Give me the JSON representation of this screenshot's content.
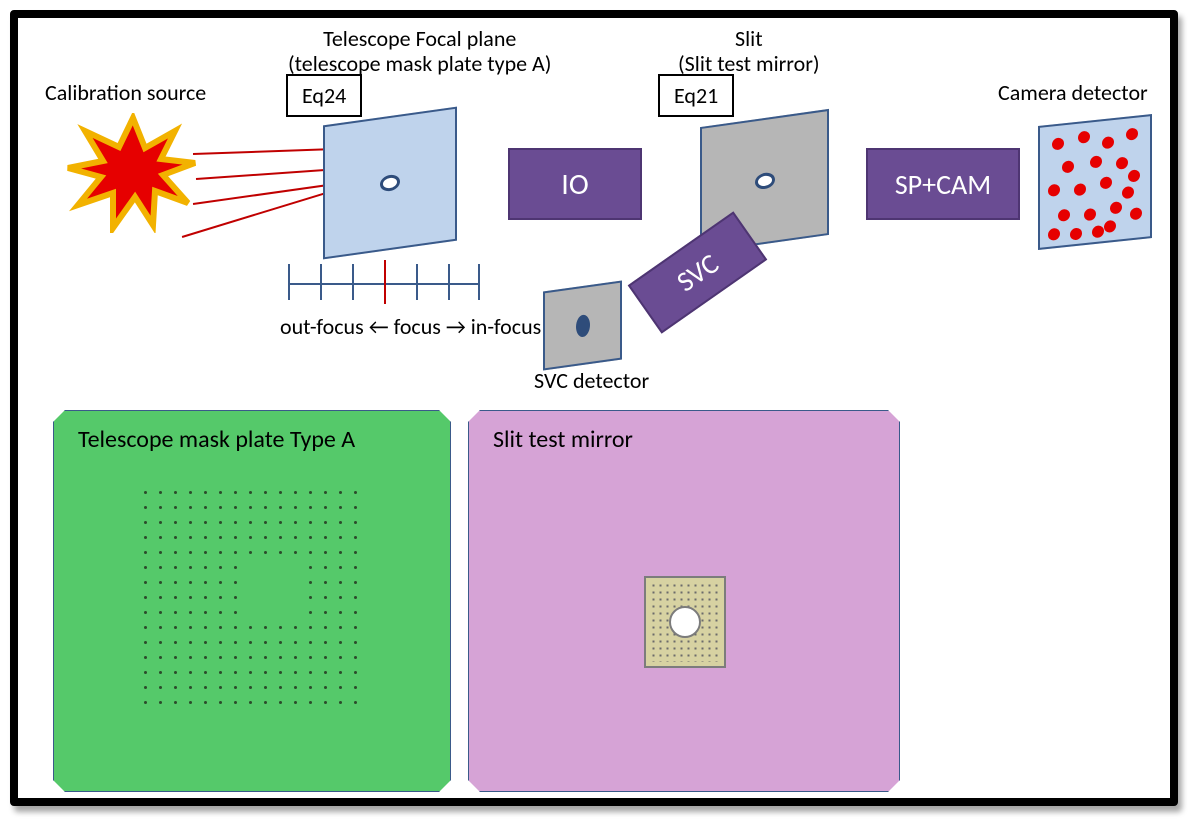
{
  "labels": {
    "calibration_source": "Calibration source",
    "telescope_focal": "Telescope Focal plane\n(telescope mask plate type A)",
    "slit": "Slit\n(Slit test mirror)",
    "camera_detector": "Camera detector",
    "svc_detector": "SVC detector",
    "focus_line": "out-focus ← focus → in-focus"
  },
  "eq": {
    "focal": "Eq24",
    "slit": "Eq21"
  },
  "blocks": {
    "io": "IO",
    "svc": "SVC",
    "spcam": "SP+CAM"
  },
  "panels": {
    "green": "Telescope mask plate Type A",
    "pink": "Slit test mirror"
  },
  "colors": {
    "purple": "#6a4c93",
    "blue_fill": "#bfd3ec",
    "blue_stroke": "#3a5a8a",
    "green_panel": "#55c96a",
    "pink_panel": "#d6a3d6",
    "red": "#c00000",
    "orange": "#f2b200"
  }
}
